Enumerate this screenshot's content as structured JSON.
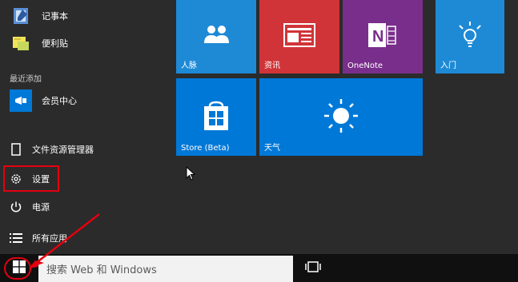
{
  "apps": {
    "notepad": "记事本",
    "sticky_notes": "便利贴",
    "recent_heading": "最近添加",
    "member_center": "会员中心"
  },
  "system": {
    "file_explorer": "文件资源管理器",
    "settings": "设置",
    "power": "电源",
    "all_apps": "所有应用"
  },
  "tiles": {
    "people": "人脉",
    "news": "资讯",
    "onenote": "OneNote",
    "get_started": "入门",
    "store": "Store (Beta)",
    "weather": "天气"
  },
  "taskbar": {
    "search_placeholder": "搜索 Web 和 Windows"
  },
  "colors": {
    "tile_blue": "#1e8ad6",
    "tile_red": "#d13438",
    "tile_purple": "#7a2e8c",
    "tile_blue_dark": "#0078d7",
    "annotation_red": "#e3000f"
  }
}
